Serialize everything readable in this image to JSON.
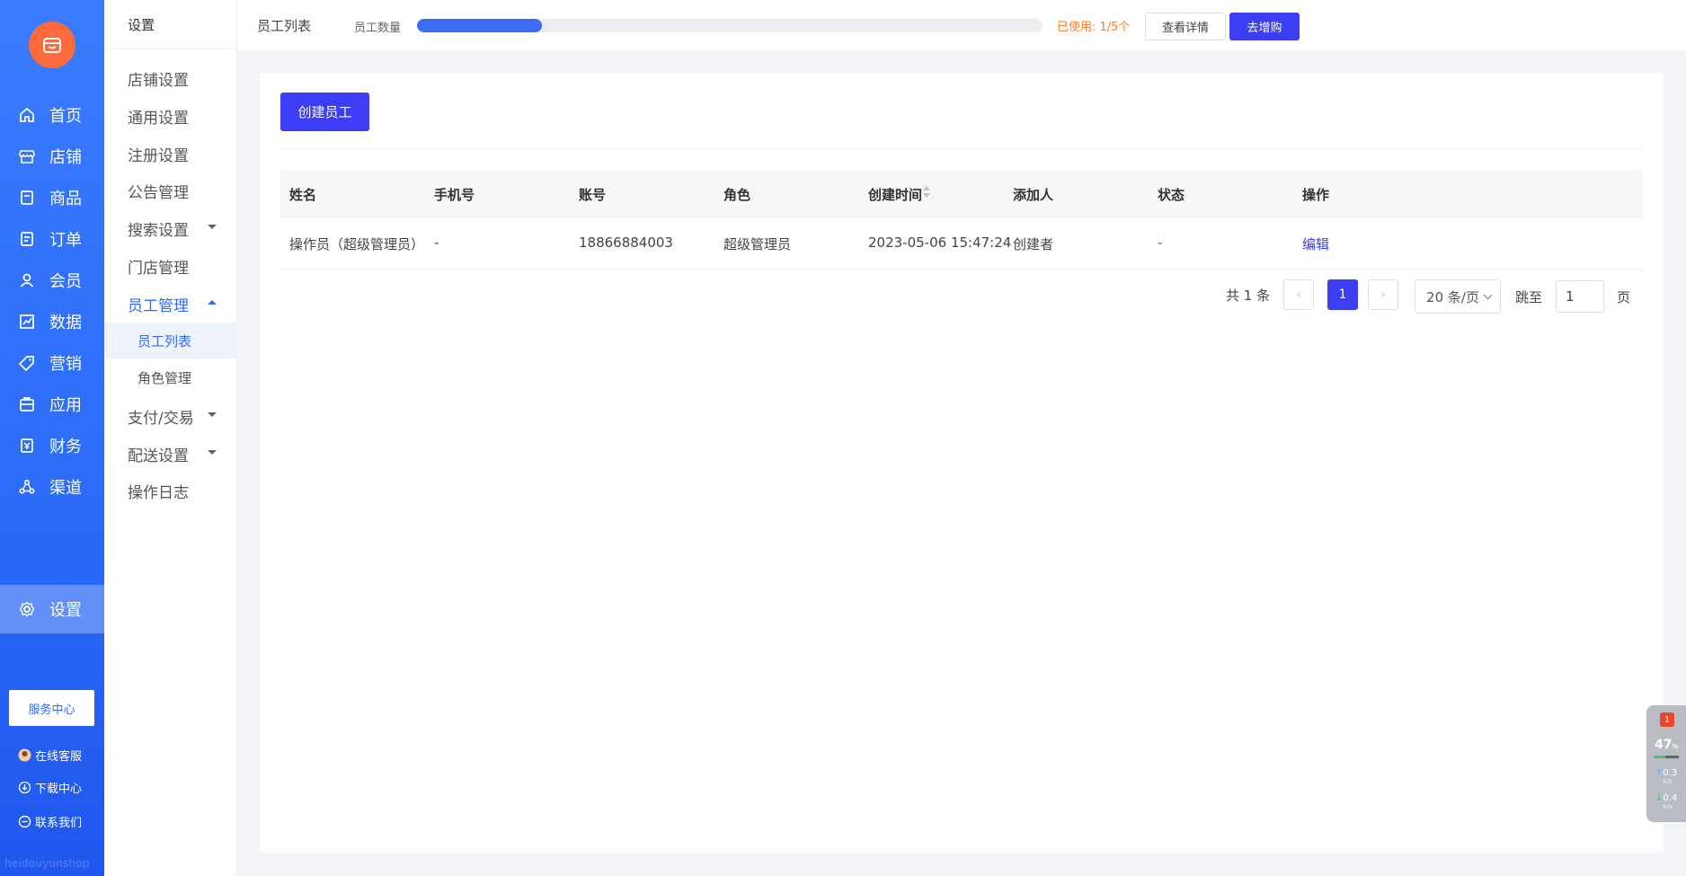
{
  "sidebar": {
    "items": [
      {
        "label": "首页",
        "icon": "home-icon"
      },
      {
        "label": "店铺",
        "icon": "store-icon"
      },
      {
        "label": "商品",
        "icon": "goods-icon"
      },
      {
        "label": "订单",
        "icon": "order-icon"
      },
      {
        "label": "会员",
        "icon": "user-icon"
      },
      {
        "label": "数据",
        "icon": "chart-icon"
      },
      {
        "label": "营销",
        "icon": "tag-icon"
      },
      {
        "label": "应用",
        "icon": "app-icon"
      },
      {
        "label": "财务",
        "icon": "finance-icon"
      },
      {
        "label": "渠道",
        "icon": "channel-icon"
      },
      {
        "label": "设置",
        "icon": "gear-icon"
      }
    ],
    "service_center": "服务中心",
    "links": [
      "在线客服",
      "下载中心",
      "联系我们"
    ],
    "watermark": "heidouyunshop"
  },
  "submenu": {
    "title": "设置",
    "items": [
      "店铺设置",
      "通用设置",
      "注册设置",
      "公告管理",
      "搜索设置",
      "门店管理",
      "员工管理"
    ],
    "sub_items": [
      "员工列表",
      "角色管理"
    ],
    "more_items": [
      "支付/交易",
      "配送设置",
      "操作日志"
    ]
  },
  "topbar": {
    "title": "员工列表",
    "quota_label": "员工数量",
    "quota_progress": 0.2,
    "used_text": "已使用: 1/5个",
    "details_button": "查看详情",
    "buy_button": "去增购"
  },
  "content": {
    "create_button": "创建员工",
    "table": {
      "headers": [
        "姓名",
        "手机号",
        "账号",
        "角色",
        "创建时间",
        "添加人",
        "状态",
        "操作"
      ],
      "rows": [
        [
          "操作员（超级管理员）",
          "-",
          "18866884003",
          "超级管理员",
          "2023-05-06 15:47:24",
          "创建者",
          "-",
          "编辑"
        ]
      ]
    },
    "pagination": {
      "total": "共 1 条",
      "prev": "‹",
      "current_page": "1",
      "next": "›",
      "page_size": "20 条/页",
      "jump_label": "跳至",
      "jump_value": "1",
      "page_suffix": "页"
    }
  },
  "widget": {
    "badge": "1",
    "percent": "47",
    "percent_unit": "%",
    "upload": "0.3",
    "download": "0.4",
    "rate_unit": "K/s"
  },
  "colors": {
    "primary": "#3b3ef5",
    "sidebar_blue": "#2c6cf8",
    "logo_orange": "#ff6a3d",
    "used_orange": "#ff7a20"
  }
}
